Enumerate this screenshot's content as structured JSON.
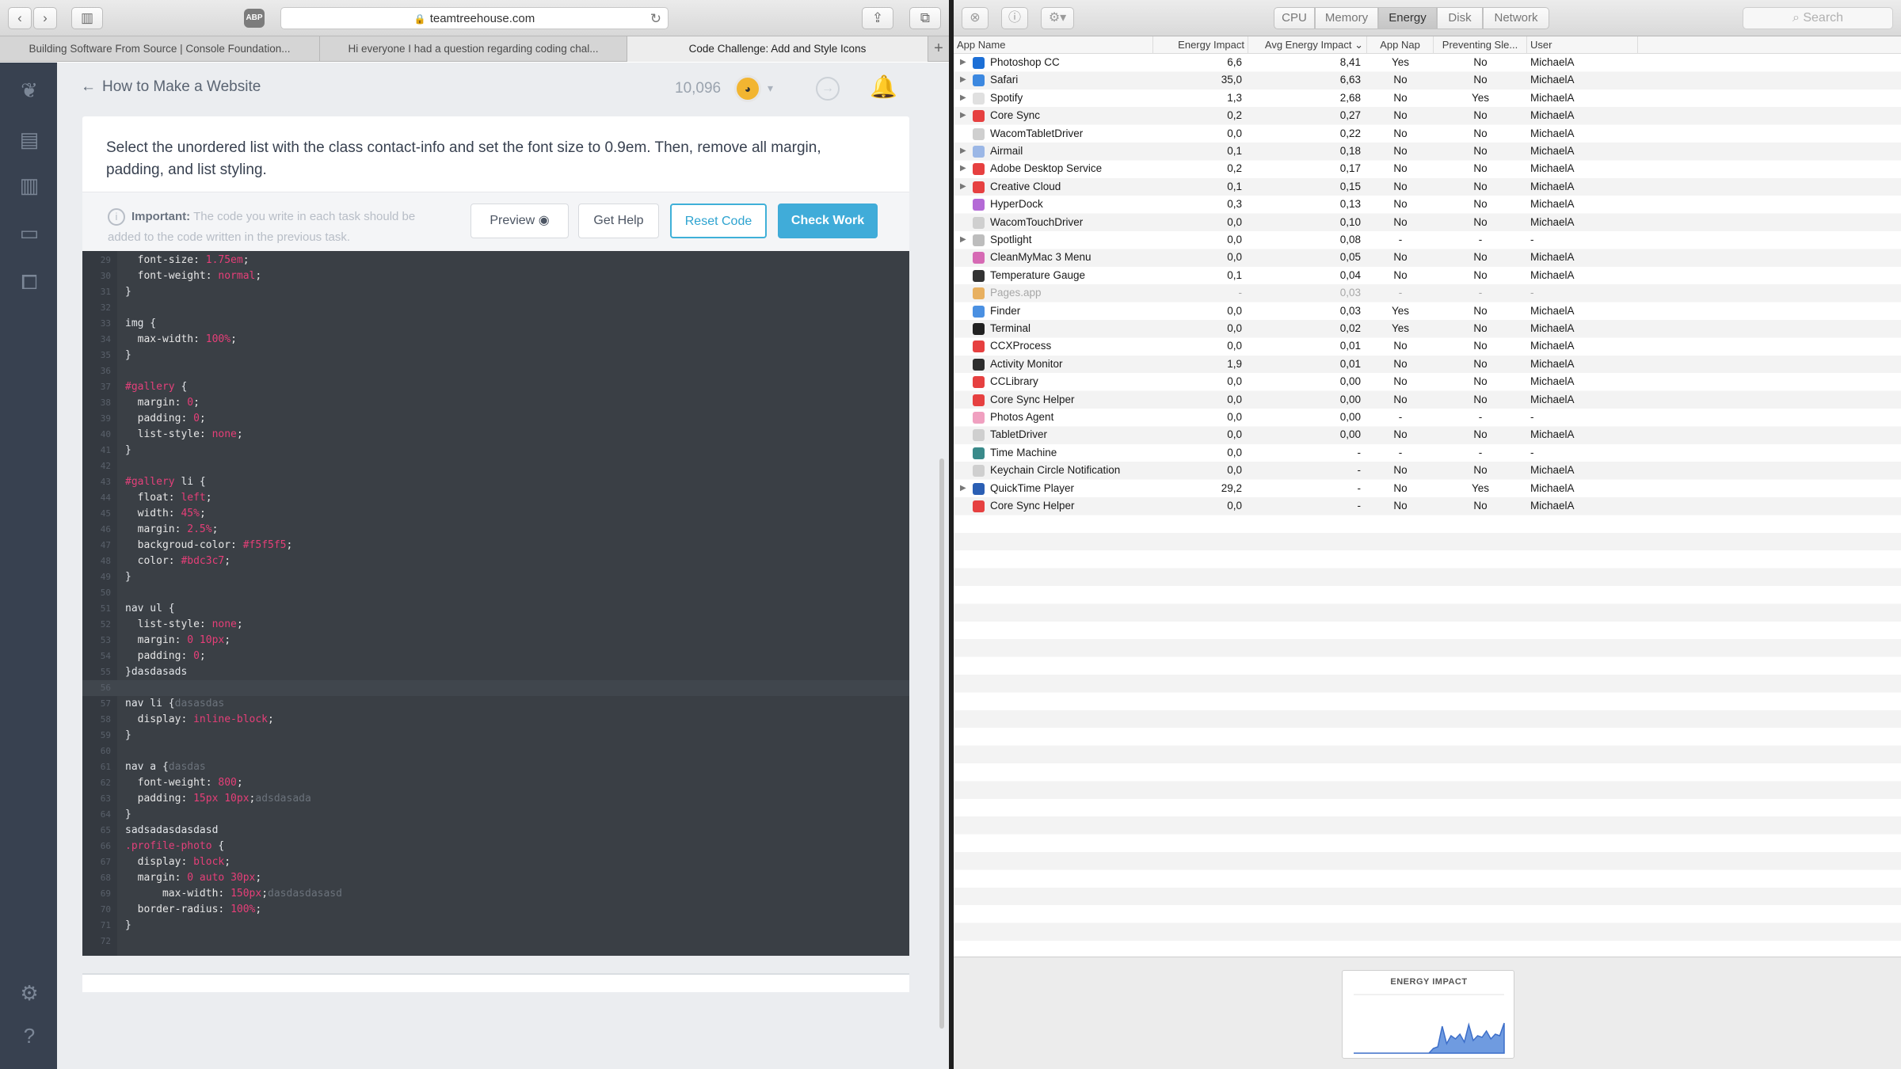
{
  "safari": {
    "adblock_label": "ABP",
    "url": "teamtreehouse.com",
    "tabs": [
      "Building Software From Source | Console Foundation...",
      "Hi everyone I had a question regarding coding chal...",
      "Code Challenge: Add and Style Icons"
    ]
  },
  "treehouse": {
    "course_title": "How to Make a Website",
    "points": "10,096",
    "task": "Select the unordered list with the class contact-info and set the font size to 0.9em. Then, remove all margin, padding, and list styling.",
    "important_label": "Important:",
    "important_text": "The code you write in each task should be added to the code written in the previous task.",
    "buttons": {
      "preview": "Preview",
      "help": "Get Help",
      "reset": "Reset Code",
      "check": "Check Work"
    }
  },
  "code": [
    {
      "n": "29",
      "t": [
        [
          "prop",
          "  font-size: "
        ],
        [
          "val",
          "1.75em"
        ],
        [
          "prop",
          ";"
        ]
      ]
    },
    {
      "n": "30",
      "t": [
        [
          "prop",
          "  font-weight: "
        ],
        [
          "val",
          "normal"
        ],
        [
          "prop",
          ";"
        ]
      ]
    },
    {
      "n": "31",
      "t": [
        [
          "sel",
          "}"
        ]
      ]
    },
    {
      "n": "32",
      "t": []
    },
    {
      "n": "33",
      "t": [
        [
          "sel",
          "img {"
        ]
      ]
    },
    {
      "n": "34",
      "t": [
        [
          "prop",
          "  max-width: "
        ],
        [
          "val",
          "100%"
        ],
        [
          "prop",
          ";"
        ]
      ]
    },
    {
      "n": "35",
      "t": [
        [
          "sel",
          "}"
        ]
      ]
    },
    {
      "n": "36",
      "t": []
    },
    {
      "n": "37",
      "t": [
        [
          "id",
          "#gallery"
        ],
        [
          "sel",
          " {"
        ]
      ]
    },
    {
      "n": "38",
      "t": [
        [
          "prop",
          "  margin: "
        ],
        [
          "val",
          "0"
        ],
        [
          "prop",
          ";"
        ]
      ]
    },
    {
      "n": "39",
      "t": [
        [
          "prop",
          "  padding: "
        ],
        [
          "val",
          "0"
        ],
        [
          "prop",
          ";"
        ]
      ]
    },
    {
      "n": "40",
      "t": [
        [
          "prop",
          "  list-style: "
        ],
        [
          "val",
          "none"
        ],
        [
          "prop",
          ";"
        ]
      ]
    },
    {
      "n": "41",
      "t": [
        [
          "sel",
          "}"
        ]
      ]
    },
    {
      "n": "42",
      "t": []
    },
    {
      "n": "43",
      "t": [
        [
          "id",
          "#gallery"
        ],
        [
          "sel",
          " li {"
        ]
      ]
    },
    {
      "n": "44",
      "t": [
        [
          "prop",
          "  float: "
        ],
        [
          "val",
          "left"
        ],
        [
          "prop",
          ";"
        ]
      ]
    },
    {
      "n": "45",
      "t": [
        [
          "prop",
          "  width: "
        ],
        [
          "val",
          "45%"
        ],
        [
          "prop",
          ";"
        ]
      ]
    },
    {
      "n": "46",
      "t": [
        [
          "prop",
          "  margin: "
        ],
        [
          "val",
          "2.5%"
        ],
        [
          "prop",
          ";"
        ]
      ]
    },
    {
      "n": "47",
      "t": [
        [
          "prop",
          "  backgroud-color: "
        ],
        [
          "val",
          "#f5f5f5"
        ],
        [
          "prop",
          ";"
        ]
      ]
    },
    {
      "n": "48",
      "t": [
        [
          "prop",
          "  color: "
        ],
        [
          "val",
          "#bdc3c7"
        ],
        [
          "prop",
          ";"
        ]
      ]
    },
    {
      "n": "49",
      "t": [
        [
          "sel",
          "}"
        ]
      ]
    },
    {
      "n": "50",
      "t": []
    },
    {
      "n": "51",
      "t": [
        [
          "sel",
          "nav ul {"
        ]
      ]
    },
    {
      "n": "52",
      "t": [
        [
          "prop",
          "  list-style: "
        ],
        [
          "val",
          "none"
        ],
        [
          "prop",
          ";"
        ]
      ]
    },
    {
      "n": "53",
      "t": [
        [
          "prop",
          "  margin: "
        ],
        [
          "val",
          "0 10px"
        ],
        [
          "prop",
          ";"
        ]
      ]
    },
    {
      "n": "54",
      "t": [
        [
          "prop",
          "  padding: "
        ],
        [
          "val",
          "0"
        ],
        [
          "prop",
          ";"
        ]
      ]
    },
    {
      "n": "55",
      "t": [
        [
          "sel",
          "}dasdasads"
        ]
      ]
    },
    {
      "n": "56",
      "t": [],
      "cur": true
    },
    {
      "n": "57",
      "t": [
        [
          "sel",
          "nav li {"
        ],
        [
          "junk",
          "dasasdas"
        ]
      ]
    },
    {
      "n": "58",
      "t": [
        [
          "prop",
          "  display: "
        ],
        [
          "val",
          "inline-block"
        ],
        [
          "prop",
          ";"
        ]
      ]
    },
    {
      "n": "59",
      "t": [
        [
          "sel",
          "}"
        ]
      ]
    },
    {
      "n": "60",
      "t": []
    },
    {
      "n": "61",
      "t": [
        [
          "sel",
          "nav a {"
        ],
        [
          "junk",
          "dasdas"
        ]
      ]
    },
    {
      "n": "62",
      "t": [
        [
          "prop",
          "  font-weight: "
        ],
        [
          "val",
          "800"
        ],
        [
          "prop",
          ";"
        ]
      ]
    },
    {
      "n": "63",
      "t": [
        [
          "prop",
          "  padding: "
        ],
        [
          "val",
          "15px 10px"
        ],
        [
          "prop",
          ";"
        ],
        [
          "junk",
          "adsdasada"
        ]
      ]
    },
    {
      "n": "64",
      "t": [
        [
          "sel",
          "}"
        ]
      ]
    },
    {
      "n": "65",
      "t": [
        [
          "sel",
          "sadsadasdasdasd"
        ]
      ]
    },
    {
      "n": "66",
      "t": [
        [
          "id",
          ".profile-photo"
        ],
        [
          "sel",
          " {"
        ]
      ]
    },
    {
      "n": "67",
      "t": [
        [
          "prop",
          "  display: "
        ],
        [
          "val",
          "block"
        ],
        [
          "prop",
          ";"
        ]
      ]
    },
    {
      "n": "68",
      "t": [
        [
          "prop",
          "  margin: "
        ],
        [
          "val",
          "0 auto 30px"
        ],
        [
          "prop",
          ";"
        ]
      ]
    },
    {
      "n": "69",
      "t": [
        [
          "prop",
          "      max-width: "
        ],
        [
          "val",
          "150px"
        ],
        [
          "prop",
          ";"
        ],
        [
          "junk",
          "dasdasdasasd"
        ]
      ]
    },
    {
      "n": "70",
      "t": [
        [
          "prop",
          "  border-radius: "
        ],
        [
          "val",
          "100%"
        ],
        [
          "prop",
          ";"
        ]
      ]
    },
    {
      "n": "71",
      "t": [
        [
          "sel",
          "}"
        ]
      ]
    },
    {
      "n": "72",
      "t": []
    }
  ],
  "am": {
    "tabs": [
      "CPU",
      "Memory",
      "Energy",
      "Disk",
      "Network"
    ],
    "search_placeholder": "Search",
    "columns": [
      "App Name",
      "Energy Impact",
      "Avg Energy Impact ⌄",
      "App Nap",
      "Preventing Sle...",
      "User"
    ],
    "graph_title": "ENERGY IMPACT",
    "graph_values": [
      0,
      0,
      0,
      0,
      0,
      0,
      0,
      0,
      0,
      0,
      0,
      0,
      0,
      0,
      0,
      0,
      0,
      0,
      0.15,
      0.2,
      0.85,
      0.3,
      0.55,
      0.45,
      0.6,
      0.35,
      0.9,
      0.4,
      0.55,
      0.5,
      0.7,
      0.45,
      0.6,
      0.55,
      0.95
    ],
    "processes": [
      {
        "name": "Photoshop CC",
        "e": "6,6",
        "avg": "8,41",
        "nap": "Yes",
        "sleep": "No",
        "user": "MichaelA",
        "exp": true,
        "color": "#1c6fd6"
      },
      {
        "name": "Safari",
        "e": "35,0",
        "avg": "6,63",
        "nap": "No",
        "sleep": "No",
        "user": "MichaelA",
        "exp": true,
        "color": "#3c88e0"
      },
      {
        "name": "Spotify",
        "e": "1,3",
        "avg": "2,68",
        "nap": "No",
        "sleep": "Yes",
        "user": "MichaelA",
        "exp": true,
        "color": "#e0e0e0"
      },
      {
        "name": "Core Sync",
        "e": "0,2",
        "avg": "0,27",
        "nap": "No",
        "sleep": "No",
        "user": "MichaelA",
        "exp": true,
        "color": "#e64040"
      },
      {
        "name": "WacomTabletDriver",
        "e": "0,0",
        "avg": "0,22",
        "nap": "No",
        "sleep": "No",
        "user": "MichaelA",
        "exp": false,
        "color": "#cfcfcf"
      },
      {
        "name": "Airmail",
        "e": "0,1",
        "avg": "0,18",
        "nap": "No",
        "sleep": "No",
        "user": "MichaelA",
        "exp": true,
        "color": "#9bb7e6"
      },
      {
        "name": "Adobe Desktop Service",
        "e": "0,2",
        "avg": "0,17",
        "nap": "No",
        "sleep": "No",
        "user": "MichaelA",
        "exp": true,
        "color": "#e64040"
      },
      {
        "name": "Creative Cloud",
        "e": "0,1",
        "avg": "0,15",
        "nap": "No",
        "sleep": "No",
        "user": "MichaelA",
        "exp": true,
        "color": "#e64040"
      },
      {
        "name": "HyperDock",
        "e": "0,3",
        "avg": "0,13",
        "nap": "No",
        "sleep": "No",
        "user": "MichaelA",
        "exp": false,
        "color": "#b46ad6"
      },
      {
        "name": "WacomTouchDriver",
        "e": "0,0",
        "avg": "0,10",
        "nap": "No",
        "sleep": "No",
        "user": "MichaelA",
        "exp": false,
        "color": "#cfcfcf"
      },
      {
        "name": "Spotlight",
        "e": "0,0",
        "avg": "0,08",
        "nap": "-",
        "sleep": "-",
        "user": "-",
        "exp": true,
        "color": "#bdbdbd"
      },
      {
        "name": "CleanMyMac 3 Menu",
        "e": "0,0",
        "avg": "0,05",
        "nap": "No",
        "sleep": "No",
        "user": "MichaelA",
        "exp": false,
        "color": "#d66ab4"
      },
      {
        "name": "Temperature Gauge",
        "e": "0,1",
        "avg": "0,04",
        "nap": "No",
        "sleep": "No",
        "user": "MichaelA",
        "exp": false,
        "color": "#333333"
      },
      {
        "name": "Pages.app",
        "e": "-",
        "avg": "0,03",
        "nap": "-",
        "sleep": "-",
        "user": "-",
        "exp": false,
        "color": "#e8b060",
        "dim": true
      },
      {
        "name": "Finder",
        "e": "0,0",
        "avg": "0,03",
        "nap": "Yes",
        "sleep": "No",
        "user": "MichaelA",
        "exp": false,
        "color": "#4a90e2"
      },
      {
        "name": "Terminal",
        "e": "0,0",
        "avg": "0,02",
        "nap": "Yes",
        "sleep": "No",
        "user": "MichaelA",
        "exp": false,
        "color": "#222222"
      },
      {
        "name": "CCXProcess",
        "e": "0,0",
        "avg": "0,01",
        "nap": "No",
        "sleep": "No",
        "user": "MichaelA",
        "exp": false,
        "color": "#e64040"
      },
      {
        "name": "Activity Monitor",
        "e": "1,9",
        "avg": "0,01",
        "nap": "No",
        "sleep": "No",
        "user": "MichaelA",
        "exp": false,
        "color": "#2d2d2d"
      },
      {
        "name": "CCLibrary",
        "e": "0,0",
        "avg": "0,00",
        "nap": "No",
        "sleep": "No",
        "user": "MichaelA",
        "exp": false,
        "color": "#e64040"
      },
      {
        "name": "Core Sync Helper",
        "e": "0,0",
        "avg": "0,00",
        "nap": "No",
        "sleep": "No",
        "user": "MichaelA",
        "exp": false,
        "color": "#e64040"
      },
      {
        "name": "Photos Agent",
        "e": "0,0",
        "avg": "0,00",
        "nap": "-",
        "sleep": "-",
        "user": "-",
        "exp": false,
        "color": "#f0a0c0"
      },
      {
        "name": "TabletDriver",
        "e": "0,0",
        "avg": "0,00",
        "nap": "No",
        "sleep": "No",
        "user": "MichaelA",
        "exp": false,
        "color": "#cfcfcf"
      },
      {
        "name": "Time Machine",
        "e": "0,0",
        "avg": "-",
        "nap": "-",
        "sleep": "-",
        "user": "-",
        "exp": false,
        "color": "#3a8a8a"
      },
      {
        "name": "Keychain Circle Notification",
        "e": "0,0",
        "avg": "-",
        "nap": "No",
        "sleep": "No",
        "user": "MichaelA",
        "exp": false,
        "color": "#cfcfcf"
      },
      {
        "name": "QuickTime Player",
        "e": "29,2",
        "avg": "-",
        "nap": "No",
        "sleep": "Yes",
        "user": "MichaelA",
        "exp": true,
        "color": "#2b5fb4"
      },
      {
        "name": "Core Sync Helper",
        "e": "0,0",
        "avg": "-",
        "nap": "No",
        "sleep": "No",
        "user": "MichaelA",
        "exp": false,
        "color": "#e64040"
      }
    ]
  }
}
